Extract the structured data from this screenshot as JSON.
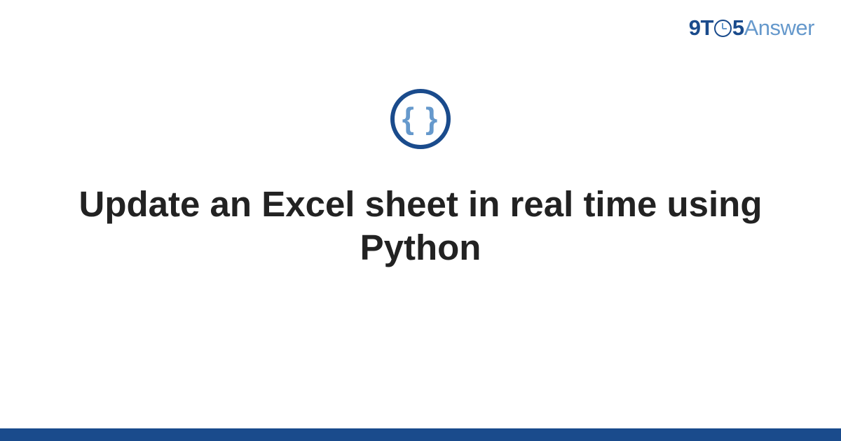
{
  "logo": {
    "part1": "9",
    "part2": "T",
    "part3": "5",
    "part4": "Answer"
  },
  "icon": {
    "glyph": "{ }",
    "name": "code-braces"
  },
  "question": {
    "title": "Update an Excel sheet in real time using Python"
  },
  "colors": {
    "brand_dark": "#1a4b8c",
    "brand_light": "#6699cc",
    "text": "#222222"
  }
}
